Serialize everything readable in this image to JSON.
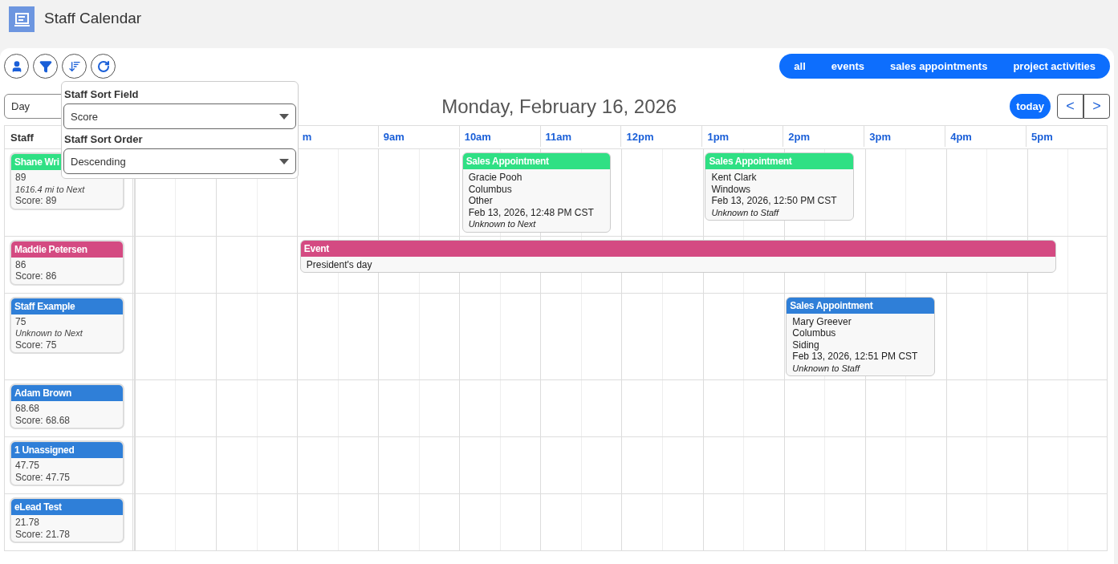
{
  "app": {
    "title": "Staff Calendar"
  },
  "toolbar": {
    "buttons": [
      {
        "kind": "user"
      },
      {
        "kind": "filter"
      },
      {
        "kind": "sort"
      },
      {
        "kind": "refresh"
      }
    ]
  },
  "filters": [
    "all",
    "events",
    "sales appointments",
    "project activities"
  ],
  "view_select": {
    "value": "Day"
  },
  "date_title": "Monday, February 16, 2026",
  "nav": {
    "today": "today",
    "prev": "<",
    "next": ">"
  },
  "sort_popover": {
    "fields": [
      {
        "label": "Staff Sort Field",
        "value": "Score"
      },
      {
        "label": "Staff Sort Order",
        "value": "Descending"
      }
    ]
  },
  "grid": {
    "staff_header": "Staff",
    "hour_labels": [
      "m",
      "9am",
      "10am",
      "11am",
      "12pm",
      "1pm",
      "2pm",
      "3pm",
      "4pm",
      "5pm"
    ],
    "rows": [
      {
        "staff": {
          "name": "Shane Wri",
          "color": "#2fe084",
          "lines": [
            {
              "text": "89",
              "kind": "plain"
            },
            {
              "text": "1616.4 mi to Next",
              "kind": "note"
            },
            {
              "text": "Score: 89",
              "kind": "plain"
            }
          ]
        },
        "events": [
          {
            "title": "Sales Appointment",
            "color": "#2fe084",
            "lines": [
              {
                "text": "Gracie Pooh",
                "kind": "plain"
              },
              {
                "text": "Columbus",
                "kind": "plain"
              },
              {
                "text": "Other",
                "kind": "plain"
              },
              {
                "text": "Feb 13, 2026, 12:48 PM CST",
                "kind": "plain"
              },
              {
                "text": "Unknown to Next",
                "kind": "note"
              }
            ]
          },
          {
            "title": "Sales Appointment",
            "color": "#2fe084",
            "lines": [
              {
                "text": "Kent Clark",
                "kind": "plain"
              },
              {
                "text": "Windows",
                "kind": "plain"
              },
              {
                "text": "Feb 13, 2026, 12:50 PM CST",
                "kind": "plain"
              },
              {
                "text": "Unknown to Staff",
                "kind": "note"
              }
            ]
          }
        ]
      },
      {
        "staff": {
          "name": "Maddie Petersen",
          "color": "#d44a82",
          "lines": [
            {
              "text": "86",
              "kind": "plain"
            },
            {
              "text": "Score: 86",
              "kind": "plain"
            }
          ]
        },
        "events": [
          {
            "title": "Event",
            "color": "#d44a82",
            "lines": [
              {
                "text": "President's day",
                "kind": "plain"
              }
            ]
          }
        ]
      },
      {
        "staff": {
          "name": "Staff Example",
          "color": "#2f7fd8",
          "lines": [
            {
              "text": "75",
              "kind": "plain"
            },
            {
              "text": "Unknown to Next",
              "kind": "note"
            },
            {
              "text": "Score: 75",
              "kind": "plain"
            }
          ]
        },
        "events": [
          {
            "title": "Sales Appointment",
            "color": "#2f7fd8",
            "lines": [
              {
                "text": "Mary Greever",
                "kind": "plain"
              },
              {
                "text": "Columbus",
                "kind": "plain"
              },
              {
                "text": "Siding",
                "kind": "plain"
              },
              {
                "text": "Feb 13, 2026, 12:51 PM CST",
                "kind": "plain"
              },
              {
                "text": "Unknown to Staff",
                "kind": "note"
              }
            ]
          }
        ]
      },
      {
        "staff": {
          "name": "Adam Brown",
          "color": "#2f7fd8",
          "lines": [
            {
              "text": "68.68",
              "kind": "plain"
            },
            {
              "text": "Score: 68.68",
              "kind": "plain"
            }
          ]
        }
      },
      {
        "staff": {
          "name": "1 Unassigned",
          "color": "#2f7fd8",
          "lines": [
            {
              "text": "47.75",
              "kind": "plain"
            },
            {
              "text": "Score: 47.75",
              "kind": "plain"
            }
          ]
        }
      },
      {
        "staff": {
          "name": "eLead Test",
          "color": "#2f7fd8",
          "lines": [
            {
              "text": "21.78",
              "kind": "plain"
            },
            {
              "text": "Score: 21.78",
              "kind": "plain"
            }
          ]
        }
      }
    ]
  }
}
